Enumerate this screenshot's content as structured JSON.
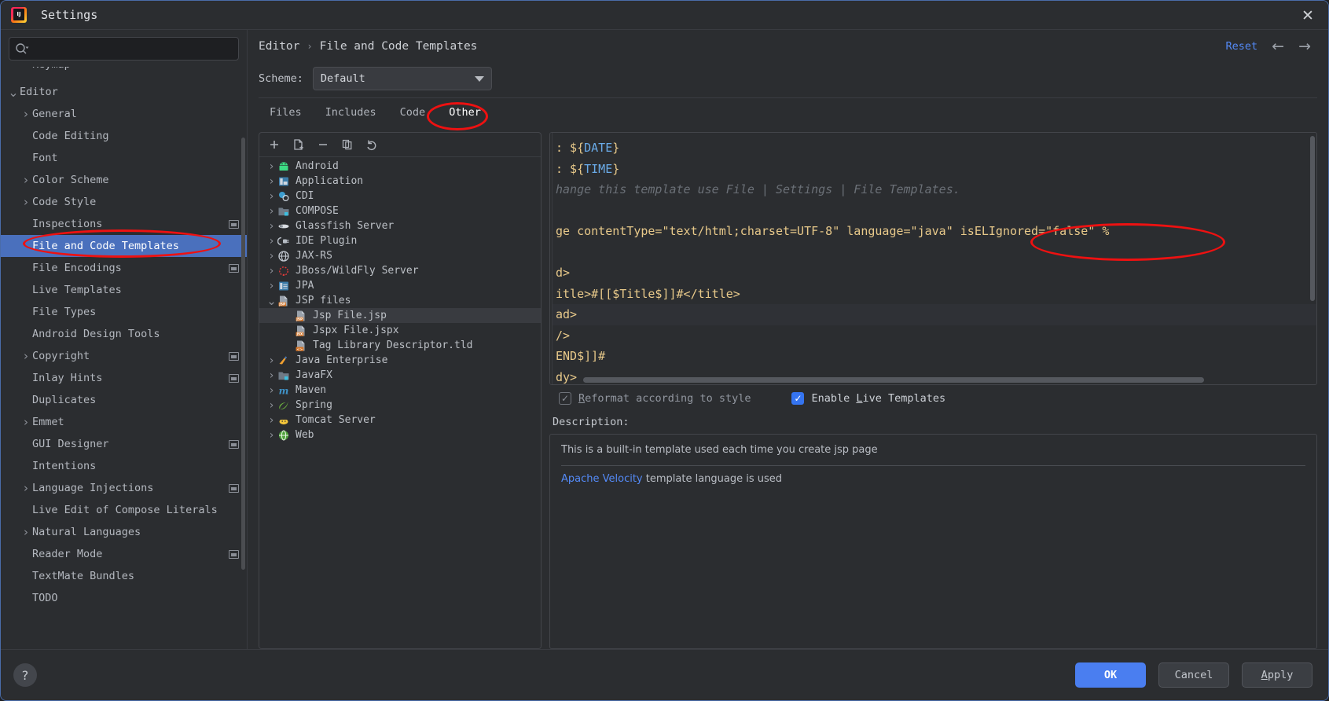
{
  "window": {
    "title": "Settings",
    "logo_icon": "intellij-idea-logo",
    "close_icon": "close-icon"
  },
  "search": {
    "icon": "search-icon",
    "placeholder": "",
    "value": ""
  },
  "sidebar": {
    "items": [
      {
        "label": "Keymap",
        "level": 1,
        "arrow": "",
        "badge": false,
        "selected": false,
        "clipped": true
      },
      {
        "label": "Editor",
        "level": 0,
        "arrow": "v",
        "badge": false,
        "selected": false
      },
      {
        "label": "General",
        "level": 1,
        "arrow": ">",
        "badge": false,
        "selected": false
      },
      {
        "label": "Code Editing",
        "level": 1,
        "arrow": "",
        "badge": false,
        "selected": false
      },
      {
        "label": "Font",
        "level": 1,
        "arrow": "",
        "badge": false,
        "selected": false
      },
      {
        "label": "Color Scheme",
        "level": 1,
        "arrow": ">",
        "badge": false,
        "selected": false
      },
      {
        "label": "Code Style",
        "level": 1,
        "arrow": ">",
        "badge": false,
        "selected": false
      },
      {
        "label": "Inspections",
        "level": 1,
        "arrow": "",
        "badge": true,
        "selected": false
      },
      {
        "label": "File and Code Templates",
        "level": 1,
        "arrow": "",
        "badge": false,
        "selected": true
      },
      {
        "label": "File Encodings",
        "level": 1,
        "arrow": "",
        "badge": true,
        "selected": false
      },
      {
        "label": "Live Templates",
        "level": 1,
        "arrow": "",
        "badge": false,
        "selected": false
      },
      {
        "label": "File Types",
        "level": 1,
        "arrow": "",
        "badge": false,
        "selected": false
      },
      {
        "label": "Android Design Tools",
        "level": 1,
        "arrow": "",
        "badge": false,
        "selected": false
      },
      {
        "label": "Copyright",
        "level": 1,
        "arrow": ">",
        "badge": true,
        "selected": false
      },
      {
        "label": "Inlay Hints",
        "level": 1,
        "arrow": "",
        "badge": true,
        "selected": false
      },
      {
        "label": "Duplicates",
        "level": 1,
        "arrow": "",
        "badge": false,
        "selected": false
      },
      {
        "label": "Emmet",
        "level": 1,
        "arrow": ">",
        "badge": false,
        "selected": false
      },
      {
        "label": "GUI Designer",
        "level": 1,
        "arrow": "",
        "badge": true,
        "selected": false
      },
      {
        "label": "Intentions",
        "level": 1,
        "arrow": "",
        "badge": false,
        "selected": false
      },
      {
        "label": "Language Injections",
        "level": 1,
        "arrow": ">",
        "badge": true,
        "selected": false
      },
      {
        "label": "Live Edit of Compose Literals",
        "level": 1,
        "arrow": "",
        "badge": false,
        "selected": false
      },
      {
        "label": "Natural Languages",
        "level": 1,
        "arrow": ">",
        "badge": false,
        "selected": false
      },
      {
        "label": "Reader Mode",
        "level": 1,
        "arrow": "",
        "badge": true,
        "selected": false
      },
      {
        "label": "TextMate Bundles",
        "level": 1,
        "arrow": "",
        "badge": false,
        "selected": false
      },
      {
        "label": "TODO",
        "level": 1,
        "arrow": "",
        "badge": false,
        "selected": false
      }
    ]
  },
  "header": {
    "breadcrumb_parent": "Editor",
    "breadcrumb_separator": "›",
    "breadcrumb_current": "File and Code Templates",
    "reset_label": "Reset",
    "back_icon": "arrow-left-icon",
    "forward_icon": "arrow-right-icon"
  },
  "scheme": {
    "label": "Scheme:",
    "value": "Default",
    "dropdown_icon": "chevron-down-icon"
  },
  "tabs": [
    {
      "label": "Files",
      "active": false
    },
    {
      "label": "Includes",
      "active": false
    },
    {
      "label": "Code",
      "active": false
    },
    {
      "label": "Other",
      "active": true
    }
  ],
  "tree_toolbar": [
    {
      "icon": "add-icon",
      "glyph": "+"
    },
    {
      "icon": "copy-template-icon",
      "glyph": ""
    },
    {
      "icon": "remove-icon",
      "glyph": "−"
    },
    {
      "icon": "duplicate-icon",
      "glyph": ""
    },
    {
      "icon": "reset-undo-icon",
      "glyph": "↶"
    }
  ],
  "template_tree": [
    {
      "label": "Android",
      "arrow": ">",
      "icon": "android-icon",
      "child": false,
      "selected": false
    },
    {
      "label": "Application",
      "arrow": ">",
      "icon": "application-icon",
      "child": false,
      "selected": false
    },
    {
      "label": "CDI",
      "arrow": ">",
      "icon": "cdi-icon",
      "child": false,
      "selected": false
    },
    {
      "label": "COMPOSE",
      "arrow": ">",
      "icon": "compose-folder-icon",
      "child": false,
      "selected": false
    },
    {
      "label": "Glassfish Server",
      "arrow": ">",
      "icon": "glassfish-icon",
      "child": false,
      "selected": false
    },
    {
      "label": "IDE Plugin",
      "arrow": ">",
      "icon": "plugin-icon",
      "child": false,
      "selected": false
    },
    {
      "label": "JAX-RS",
      "arrow": ">",
      "icon": "globe-icon",
      "child": false,
      "selected": false
    },
    {
      "label": "JBoss/WildFly Server",
      "arrow": ">",
      "icon": "jboss-icon",
      "child": false,
      "selected": false
    },
    {
      "label": "JPA",
      "arrow": ">",
      "icon": "jpa-icon",
      "child": false,
      "selected": false
    },
    {
      "label": "JSP files",
      "arrow": "v",
      "icon": "jsp-folder-icon",
      "child": false,
      "selected": false
    },
    {
      "label": "Jsp File.jsp",
      "arrow": "",
      "icon": "jsp-file-icon",
      "child": true,
      "selected": true
    },
    {
      "label": "Jspx File.jspx",
      "arrow": "",
      "icon": "jspx-file-icon",
      "child": true,
      "selected": false
    },
    {
      "label": "Tag Library Descriptor.tld",
      "arrow": "",
      "icon": "tld-file-icon",
      "child": true,
      "selected": false
    },
    {
      "label": "Java Enterprise",
      "arrow": ">",
      "icon": "java-enterprise-icon",
      "child": false,
      "selected": false
    },
    {
      "label": "JavaFX",
      "arrow": ">",
      "icon": "javafx-icon",
      "child": false,
      "selected": false
    },
    {
      "label": "Maven",
      "arrow": ">",
      "icon": "maven-icon",
      "child": false,
      "selected": false
    },
    {
      "label": "Spring",
      "arrow": ">",
      "icon": "spring-icon",
      "child": false,
      "selected": false
    },
    {
      "label": "Tomcat Server",
      "arrow": ">",
      "icon": "tomcat-icon",
      "child": false,
      "selected": false
    },
    {
      "label": "Web",
      "arrow": ">",
      "icon": "web-icon",
      "child": false,
      "selected": false
    }
  ],
  "editor": {
    "lines": [
      {
        "text": ": ${DATE}",
        "kind": "var",
        "highlight": false
      },
      {
        "text": ": ${TIME}",
        "kind": "var",
        "highlight": false
      },
      {
        "text": "hange this template use File | Settings | File Templates.",
        "kind": "comment",
        "highlight": false
      },
      {
        "text": "",
        "kind": "plain",
        "highlight": false
      },
      {
        "text": "ge contentType=\"text/html;charset=UTF-8\" language=\"java\" isELIgnored=\"false\" %",
        "kind": "plain",
        "highlight": false
      },
      {
        "text": "",
        "kind": "plain",
        "highlight": false
      },
      {
        "text": "d>",
        "kind": "plain",
        "highlight": false
      },
      {
        "text": "itle>#[[$Title$]]#</title>",
        "kind": "plain",
        "highlight": false
      },
      {
        "text": "ad>",
        "kind": "plain",
        "highlight": true
      },
      {
        "text": "/>",
        "kind": "plain",
        "highlight": false
      },
      {
        "text": "END$]]#",
        "kind": "plain",
        "highlight": false
      },
      {
        "text": "dy>",
        "kind": "plain",
        "highlight": false
      }
    ]
  },
  "options": {
    "reformat": {
      "label_prefix": "",
      "mnemonic": "R",
      "label_rest": "eformat according to style",
      "checked": true,
      "enabled": false
    },
    "live_templates": {
      "label_prefix": "Enable ",
      "mnemonic": "L",
      "label_rest": "ive Templates",
      "checked": true,
      "enabled": true
    }
  },
  "description": {
    "title": "Description:",
    "text": "This is a built-in template used each time you create jsp page",
    "velocity_link": "Apache Velocity",
    "velocity_rest": " template language is used"
  },
  "footer": {
    "help_icon": "help-icon",
    "help_glyph": "?",
    "ok_label": "OK",
    "cancel_label": "Cancel",
    "apply_label": "Apply"
  },
  "annotations": [
    {
      "name": "sidebar-highlight",
      "color": "#ee1111"
    },
    {
      "name": "other-tab-highlight",
      "color": "#ee1111"
    },
    {
      "name": "is-el-ignored-highlight",
      "color": "#ee1111"
    }
  ]
}
